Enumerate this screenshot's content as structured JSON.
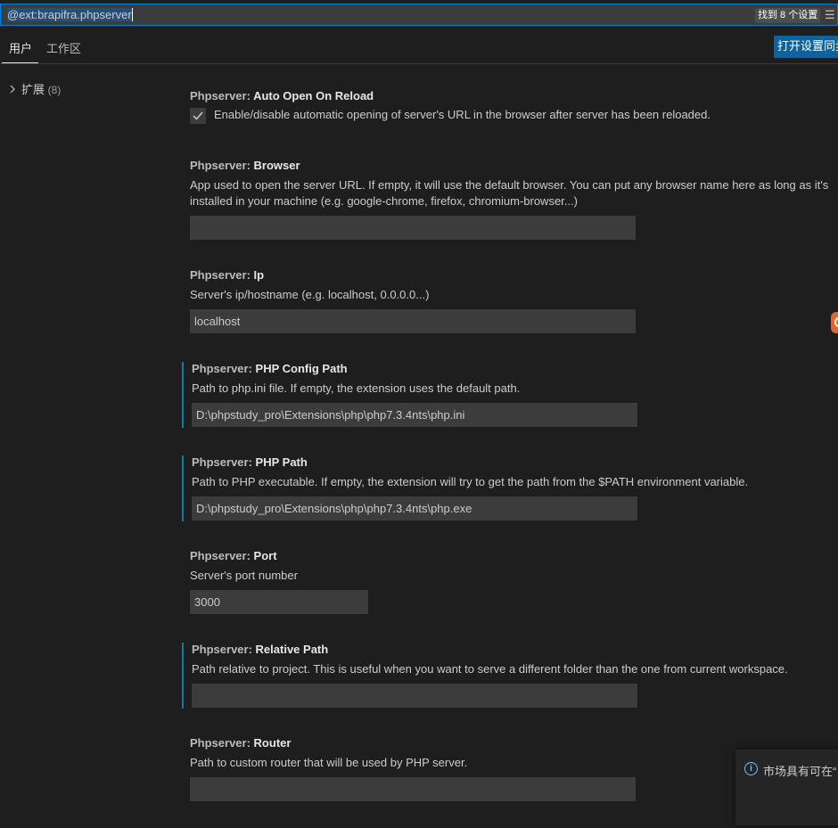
{
  "search": {
    "query": "@ext:brapifra.phpserver",
    "result_count": "找到 8 个设置",
    "filter_icon": "filter-icon"
  },
  "tabs": [
    {
      "label": "用户",
      "active": true
    },
    {
      "label": "工作区",
      "active": false
    }
  ],
  "sync_button": "打开设置同步",
  "toc": {
    "item_label": "扩展",
    "item_count": "(8)"
  },
  "settings": [
    {
      "category": "Phpserver: ",
      "key": "Auto Open On Reload",
      "type": "checkbox",
      "checked": true,
      "description": "Enable/disable automatic opening of server's URL in the browser after server has been reloaded."
    },
    {
      "category": "Phpserver: ",
      "key": "Browser",
      "type": "text",
      "description": "App used to open the server URL. If empty, it will use the default browser. You can put any browser name here as long as it's installed in your machine (e.g. google-chrome, firefox, chromium-browser...)",
      "value": ""
    },
    {
      "category": "Phpserver: ",
      "key": "Ip",
      "type": "text",
      "description": "Server's ip/hostname (e.g. localhost, 0.0.0.0...)",
      "value": "localhost"
    },
    {
      "category": "Phpserver: ",
      "key": "PHP Config Path",
      "type": "text",
      "modified": true,
      "description": "Path to php.ini file. If empty, the extension uses the default path.",
      "value": "D:\\phpstudy_pro\\Extensions\\php\\php7.3.4nts\\php.ini"
    },
    {
      "category": "Phpserver: ",
      "key": "PHP Path",
      "type": "text",
      "modified": true,
      "description": "Path to PHP executable. If empty, the extension will try to get the path from the $PATH environment variable.",
      "value": "D:\\phpstudy_pro\\Extensions\\php\\php7.3.4nts\\php.exe"
    },
    {
      "category": "Phpserver: ",
      "key": "Port",
      "type": "number",
      "description": "Server's port number",
      "value": "3000"
    },
    {
      "category": "Phpserver: ",
      "key": "Relative Path",
      "type": "text",
      "modified": true,
      "description": "Path relative to project. This is useful when you want to serve a different folder than the one from current workspace.",
      "value": ""
    },
    {
      "category": "Phpserver: ",
      "key": "Router",
      "type": "text",
      "description": "Path to custom router that will be used by PHP server.",
      "value": ""
    }
  ],
  "notification": {
    "icon": "info-icon",
    "message": "市场具有可在“"
  },
  "colors": {
    "background": "#1e1e1e",
    "input_background": "#3c3c3c",
    "accent_button": "#0e639c",
    "modified_indicator": "#0c7d9d",
    "focus_border": "#007fd4"
  }
}
